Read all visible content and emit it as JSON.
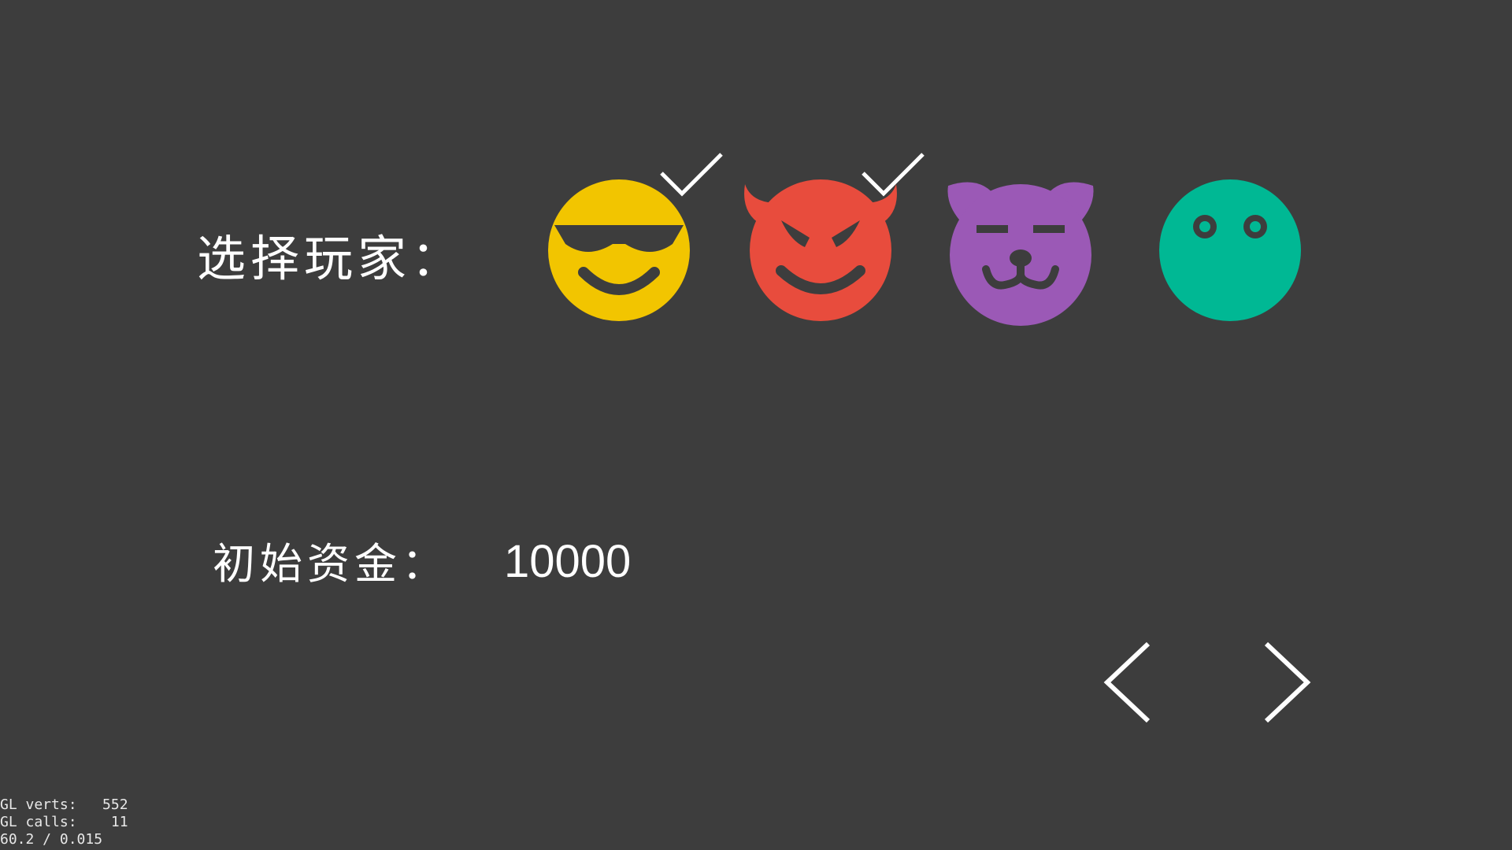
{
  "players": {
    "label": "选择玩家：",
    "avatars": [
      {
        "icon": "cool-sunglasses-face-icon",
        "color": "#f2c500",
        "selected": true
      },
      {
        "icon": "devil-face-icon",
        "color": "#e84c3d",
        "selected": true
      },
      {
        "icon": "bear-face-icon",
        "color": "#9b59b6",
        "selected": false
      },
      {
        "icon": "plain-green-face-icon",
        "color": "#00b894",
        "selected": false
      }
    ]
  },
  "funds": {
    "label": "初始资金：",
    "value": "10000"
  },
  "navigation": {
    "prev_icon": "chevron-left-icon",
    "next_icon": "chevron-right-icon"
  },
  "debug": {
    "verts": "GL verts:   552",
    "calls": "GL calls:    11",
    "fps": "60.2 / 0.015"
  }
}
